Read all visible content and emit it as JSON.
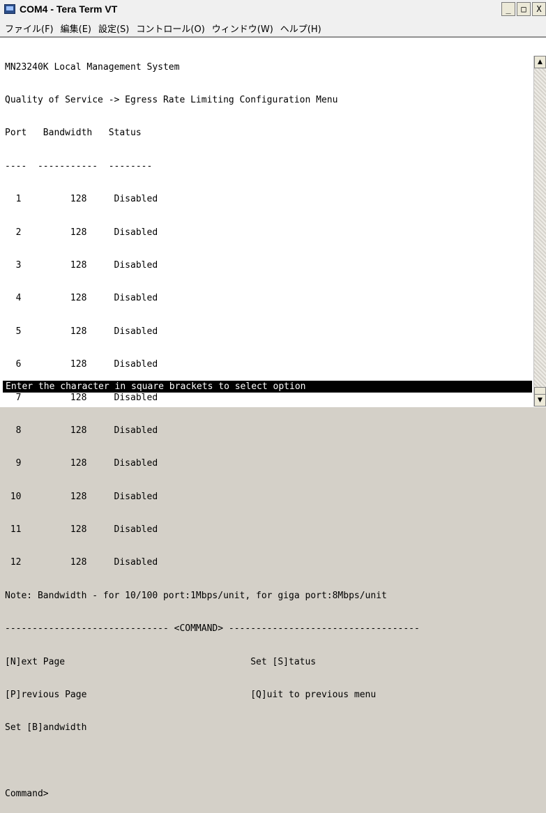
{
  "window": {
    "title": "COM4 - Tera Term VT",
    "minimize_label": "_",
    "maximize_label": "□",
    "close_label": "X"
  },
  "menu": [
    {
      "label": "ファイル(F)"
    },
    {
      "label": "編集(E)"
    },
    {
      "label": "設定(S)"
    },
    {
      "label": "コントロール(O)"
    },
    {
      "label": "ウィンドウ(W)"
    },
    {
      "label": "ヘルプ(H)"
    }
  ],
  "terminal": {
    "lines": [
      "MN23240K Local Management System",
      "Quality of Service -> Egress Rate Limiting Configuration Menu",
      "Port   Bandwidth   Status",
      "----  -----------  --------",
      "  1         128     Disabled",
      "  2         128     Disabled",
      "  3         128     Disabled",
      "  4         128     Disabled",
      "  5         128     Disabled",
      "  6         128     Disabled",
      "  7         128     Disabled",
      "  8         128     Disabled",
      "  9         128     Disabled",
      " 10         128     Disabled",
      " 11         128     Disabled",
      " 12         128     Disabled",
      "Note: Bandwidth - for 10/100 port:1Mbps/unit, for giga port:8Mbps/unit",
      "------------------------------ <COMMAND> -----------------------------------",
      "[N]ext Page                                  Set [S]tatus",
      "[P]revious Page                              [Q]uit to previous menu",
      "Set [B]andwidth",
      "",
      "Command>"
    ],
    "status_line": "Enter the character in square brackets to select option"
  },
  "icons": {
    "app": "teraterm-app-icon",
    "scroll_up": "up-arrow-icon",
    "scroll_down": "down-arrow-icon"
  }
}
